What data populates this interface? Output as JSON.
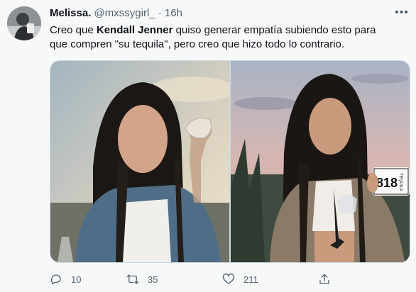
{
  "tweet": {
    "display_name": "Melissa.",
    "handle": "@mxssygirl_",
    "separator": "·",
    "time": "16h",
    "text_before": "Creo que ",
    "text_bold": "Kendall Jenner",
    "text_after": " quiso generar empatía subiendo esto para que compren \"su tequila\", pero creo que hizo todo lo contrario.",
    "more_icon": "ellipsis-icon"
  },
  "media": {
    "bottle_label_number": "818",
    "bottle_label_text": "TEQUILA"
  },
  "actions": {
    "replies": "10",
    "retweets": "35",
    "likes": "211",
    "icons": [
      "reply-icon",
      "retweet-icon",
      "like-icon",
      "share-icon"
    ]
  },
  "colors": {
    "name": "#0f1419",
    "muted": "#536471",
    "background": "#f7f9f9",
    "border": "#cfd9de"
  }
}
